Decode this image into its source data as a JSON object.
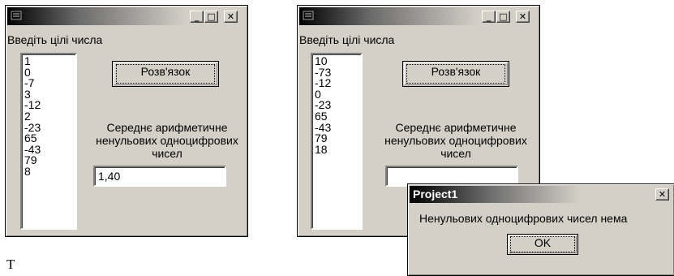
{
  "window1": {
    "title_buttons": {
      "minimize": "_",
      "maximize": "□",
      "close": "✕"
    },
    "prompt": "Введіть цілі числа",
    "list_items": [
      "1",
      "0",
      "-7",
      "3",
      "-12",
      "2",
      "-23",
      "65",
      "-43",
      "79",
      "8"
    ],
    "solve_button": "Розв'язок",
    "result_label_1": "Середнє арифметичне",
    "result_label_2": "ненульових одноцифрових",
    "result_label_3": "чисел",
    "result_value": "1,40"
  },
  "window2": {
    "title_buttons": {
      "minimize": "_",
      "maximize": "□",
      "close": "✕"
    },
    "prompt": "Введіть цілі числа",
    "list_items": [
      "10",
      "-73",
      "-12",
      "0",
      "-23",
      "65",
      "-43",
      "79",
      "18"
    ],
    "solve_button": "Розв'язок",
    "result_label_1": "Середнє арифметичне",
    "result_label_2": "ненульових одноцифрових",
    "result_label_3": "чисел",
    "result_value": ""
  },
  "dialog": {
    "title": "Project1",
    "close": "✕",
    "message": "Ненульових одноцифрових чисел нема",
    "ok_button": "OK"
  },
  "footer_text": "Т"
}
